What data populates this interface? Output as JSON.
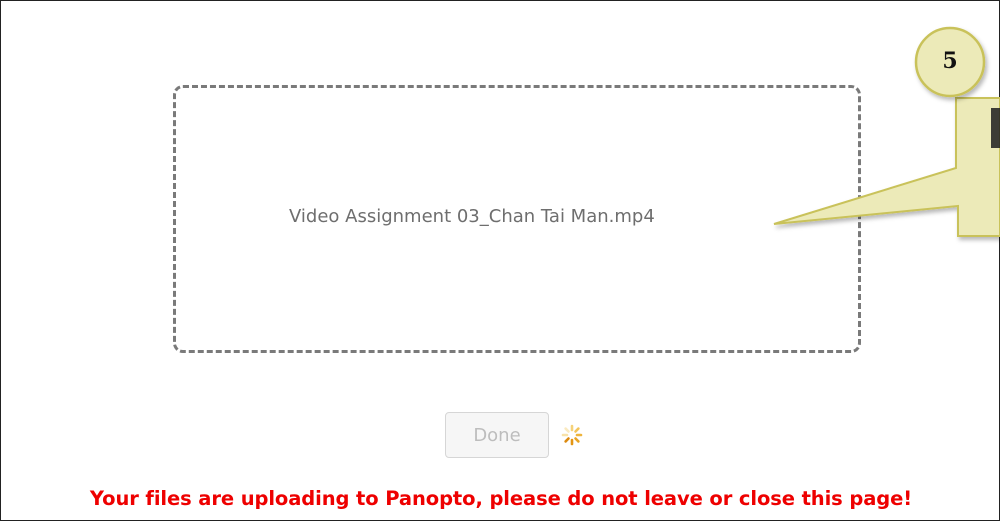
{
  "upload": {
    "file_name": "Video Assignment 03_Chan Tai Man.mp4",
    "done_label": "Done",
    "status_message": "Your files are uploading to Panopto, please do not leave or close this page!"
  },
  "annotation": {
    "step_number": "5"
  },
  "colors": {
    "warning": "#ee0000",
    "callout_fill": "#eceab8",
    "callout_border": "#c9c25a",
    "dropzone_border": "#7a7a7a"
  },
  "icons": {
    "spinner": "loading-spinner-icon"
  }
}
